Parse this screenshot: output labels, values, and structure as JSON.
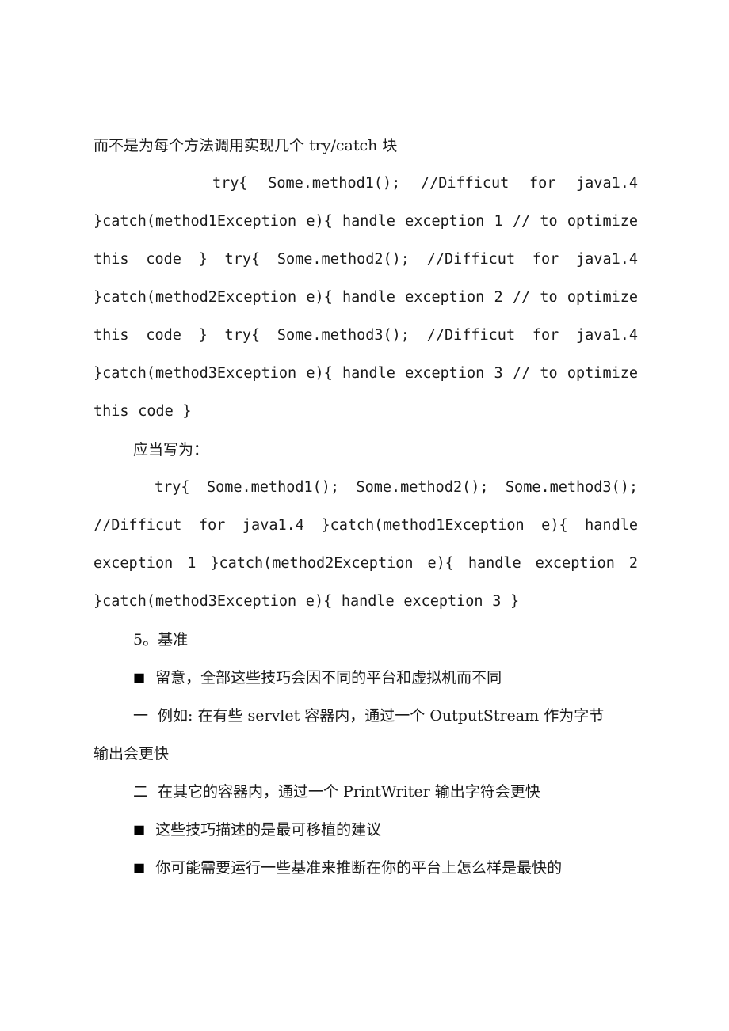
{
  "document": {
    "intro_line": "而不是为每个方法调用实现几个 try/catch 块",
    "code_block_1": {
      "indent_text": "",
      "text": "try{      Some.method1();      //Difficut    for    java1.4 }catch(method1Exception e){ handle exception 1 // to optimize this code } try{ Some.method2(); //Difficut for java1.4 }catch(method2Exception e){ handle exception 2 // to optimize this code } try{ Some.method3(); //Difficut for java1.4 }catch(method3Exception e){ handle exception 3 // to optimize this code }"
    },
    "should_write_label": "应当写为：",
    "code_block_2": {
      "text": "try{ Some.method1(); Some.method2(); Some.method3(); //Difficut for java1.4 }catch(method1Exception e){ handle exception 1 }catch(method2Exception e){ handle exception 2 }catch(method3Exception e){ handle exception 3 }"
    },
    "section_heading": "5。基准",
    "bullets": [
      {
        "marker": "■",
        "marker_type": "square",
        "text": "留意，全部这些技巧会因不同的平台和虚拟机而不同"
      },
      {
        "marker": "一",
        "marker_type": "dash-one",
        "text": "例如: 在有些 servlet 容器内，通过一个 OutputStream 作为字节",
        "continuation": "输出会更快"
      },
      {
        "marker": "二",
        "marker_type": "dash-two",
        "text": "在其它的容器内，通过一个 PrintWriter 输出字符会更快"
      },
      {
        "marker": "■",
        "marker_type": "square",
        "text": "这些技巧描述的是最可移植的建议"
      },
      {
        "marker": "■",
        "marker_type": "square",
        "text": "你可能需要运行一些基准来推断在你的平台上怎么样是最快的"
      }
    ]
  },
  "style": {
    "text_color": "#1b1b1b",
    "background": "#ffffff"
  }
}
